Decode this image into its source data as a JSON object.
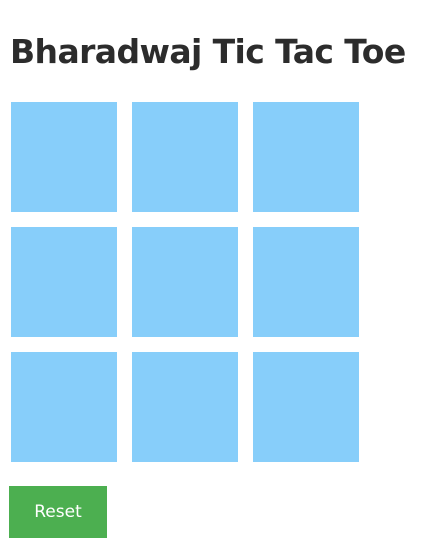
{
  "title": "Bharadwaj Tic Tac Toe",
  "board": {
    "cells": [
      "",
      "",
      "",
      "",
      "",
      "",
      "",
      "",
      ""
    ],
    "cell_color": "#87cefa"
  },
  "reset_button": {
    "label": "Reset",
    "color": "#4caf50"
  }
}
